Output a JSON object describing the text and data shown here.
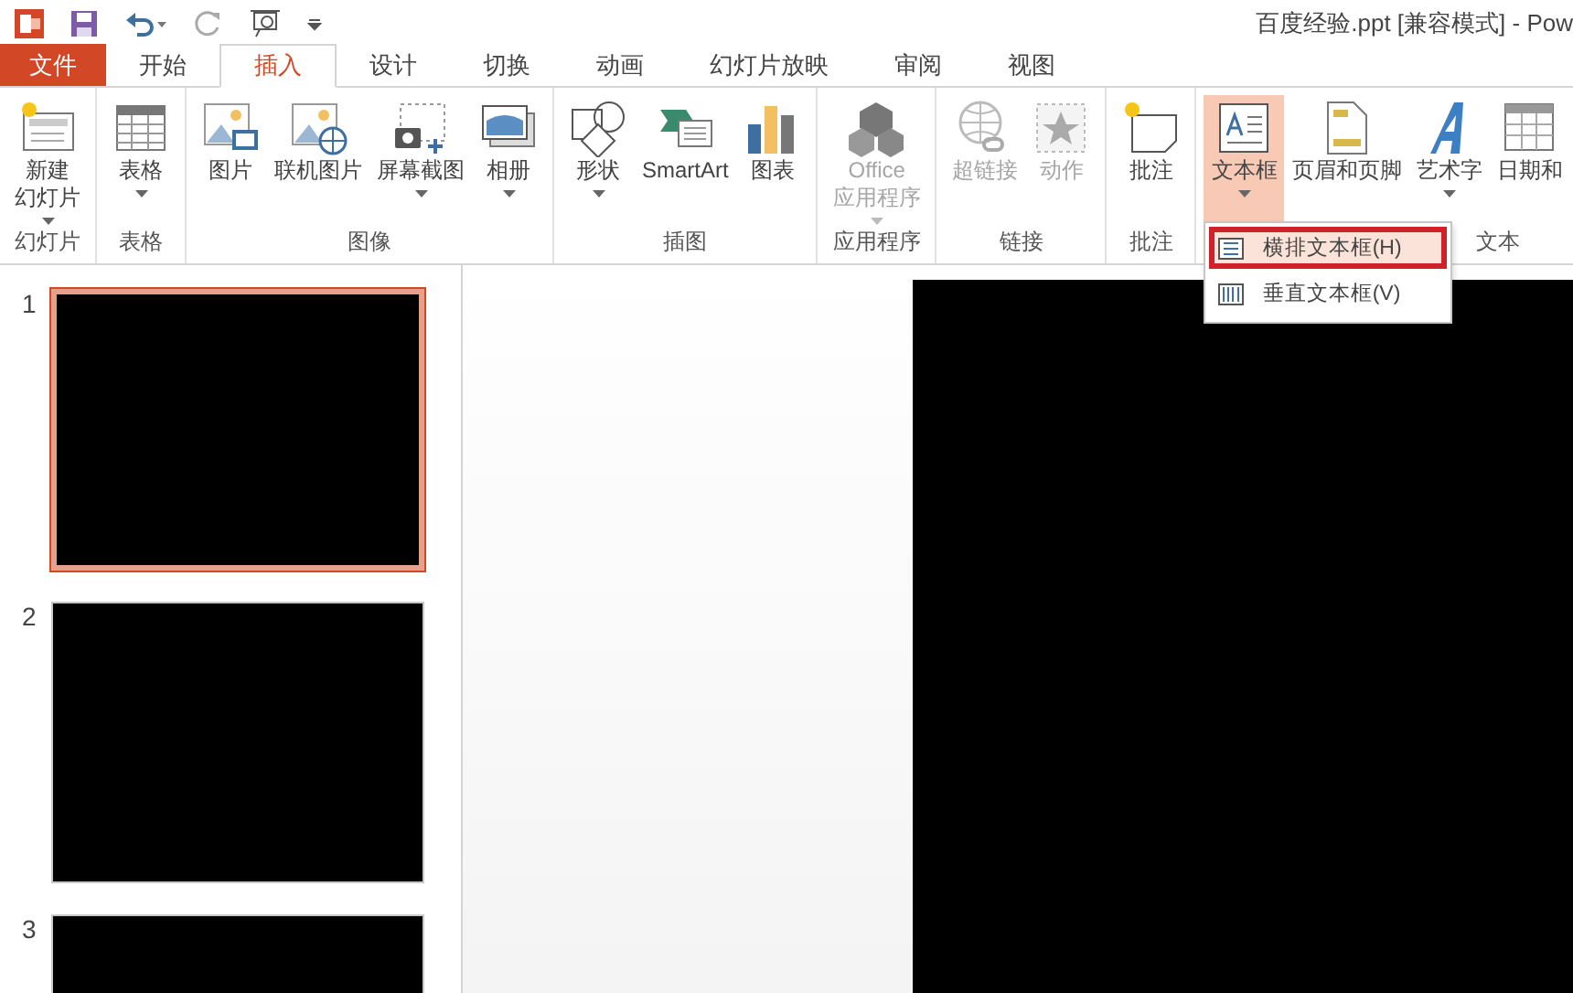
{
  "window": {
    "title": "百度经验.ppt [兼容模式] - Pow"
  },
  "tabs": [
    {
      "label": "文件",
      "kind": "file",
      "selected": false
    },
    {
      "label": "开始",
      "kind": "tab",
      "selected": false
    },
    {
      "label": "插入",
      "kind": "tab",
      "selected": true
    },
    {
      "label": "设计",
      "kind": "tab",
      "selected": false
    },
    {
      "label": "切换",
      "kind": "tab",
      "selected": false
    },
    {
      "label": "动画",
      "kind": "tab",
      "selected": false
    },
    {
      "label": "幻灯片放映",
      "kind": "tab",
      "selected": false
    },
    {
      "label": "审阅",
      "kind": "tab",
      "selected": false
    },
    {
      "label": "视图",
      "kind": "tab",
      "selected": false
    }
  ],
  "ribbon_groups": [
    {
      "label": "幻灯片",
      "buttons": [
        {
          "lines": [
            "新建",
            "幻灯片"
          ],
          "dropdown": true,
          "disabled": false,
          "selected": false
        }
      ]
    },
    {
      "label": "表格",
      "buttons": [
        {
          "lines": [
            "表格"
          ],
          "dropdown": true,
          "disabled": false,
          "selected": false
        }
      ]
    },
    {
      "label": "图像",
      "buttons": [
        {
          "lines": [
            "图片"
          ],
          "dropdown": false,
          "disabled": false,
          "selected": false
        },
        {
          "lines": [
            "联机图片"
          ],
          "dropdown": false,
          "disabled": false,
          "selected": false
        },
        {
          "lines": [
            "屏幕截图"
          ],
          "dropdown": true,
          "disabled": false,
          "selected": false
        },
        {
          "lines": [
            "相册"
          ],
          "dropdown": true,
          "disabled": false,
          "selected": false
        }
      ]
    },
    {
      "label": "插图",
      "buttons": [
        {
          "lines": [
            "形状"
          ],
          "dropdown": true,
          "disabled": false,
          "selected": false
        },
        {
          "lines": [
            "SmartArt"
          ],
          "dropdown": false,
          "disabled": false,
          "selected": false
        },
        {
          "lines": [
            "图表"
          ],
          "dropdown": false,
          "disabled": false,
          "selected": false
        }
      ]
    },
    {
      "label": "应用程序",
      "buttons": [
        {
          "lines": [
            "Office",
            "应用程序"
          ],
          "dropdown": true,
          "disabled": true,
          "selected": false
        }
      ]
    },
    {
      "label": "链接",
      "buttons": [
        {
          "lines": [
            "超链接"
          ],
          "dropdown": false,
          "disabled": true,
          "selected": false
        },
        {
          "lines": [
            "动作"
          ],
          "dropdown": false,
          "disabled": true,
          "selected": false
        }
      ]
    },
    {
      "label": "批注",
      "buttons": [
        {
          "lines": [
            "批注"
          ],
          "dropdown": false,
          "disabled": false,
          "selected": false
        }
      ]
    },
    {
      "label": "文本",
      "buttons": [
        {
          "lines": [
            "文本框"
          ],
          "dropdown": true,
          "disabled": false,
          "selected": true,
          "menu": [
            {
              "label": "横排文本框(H)",
              "selected": true
            },
            {
              "label": "垂直文本框(V)",
              "selected": false
            }
          ]
        },
        {
          "lines": [
            "页眉和页脚"
          ],
          "dropdown": false,
          "disabled": false,
          "selected": false
        },
        {
          "lines": [
            "艺术字"
          ],
          "dropdown": true,
          "disabled": false,
          "selected": false
        },
        {
          "lines": [
            "日期和"
          ],
          "dropdown": false,
          "disabled": false,
          "selected": false
        }
      ]
    }
  ],
  "slides": [
    {
      "number": "1",
      "selected": true
    },
    {
      "number": "2",
      "selected": false
    },
    {
      "number": "3",
      "selected": false
    }
  ]
}
